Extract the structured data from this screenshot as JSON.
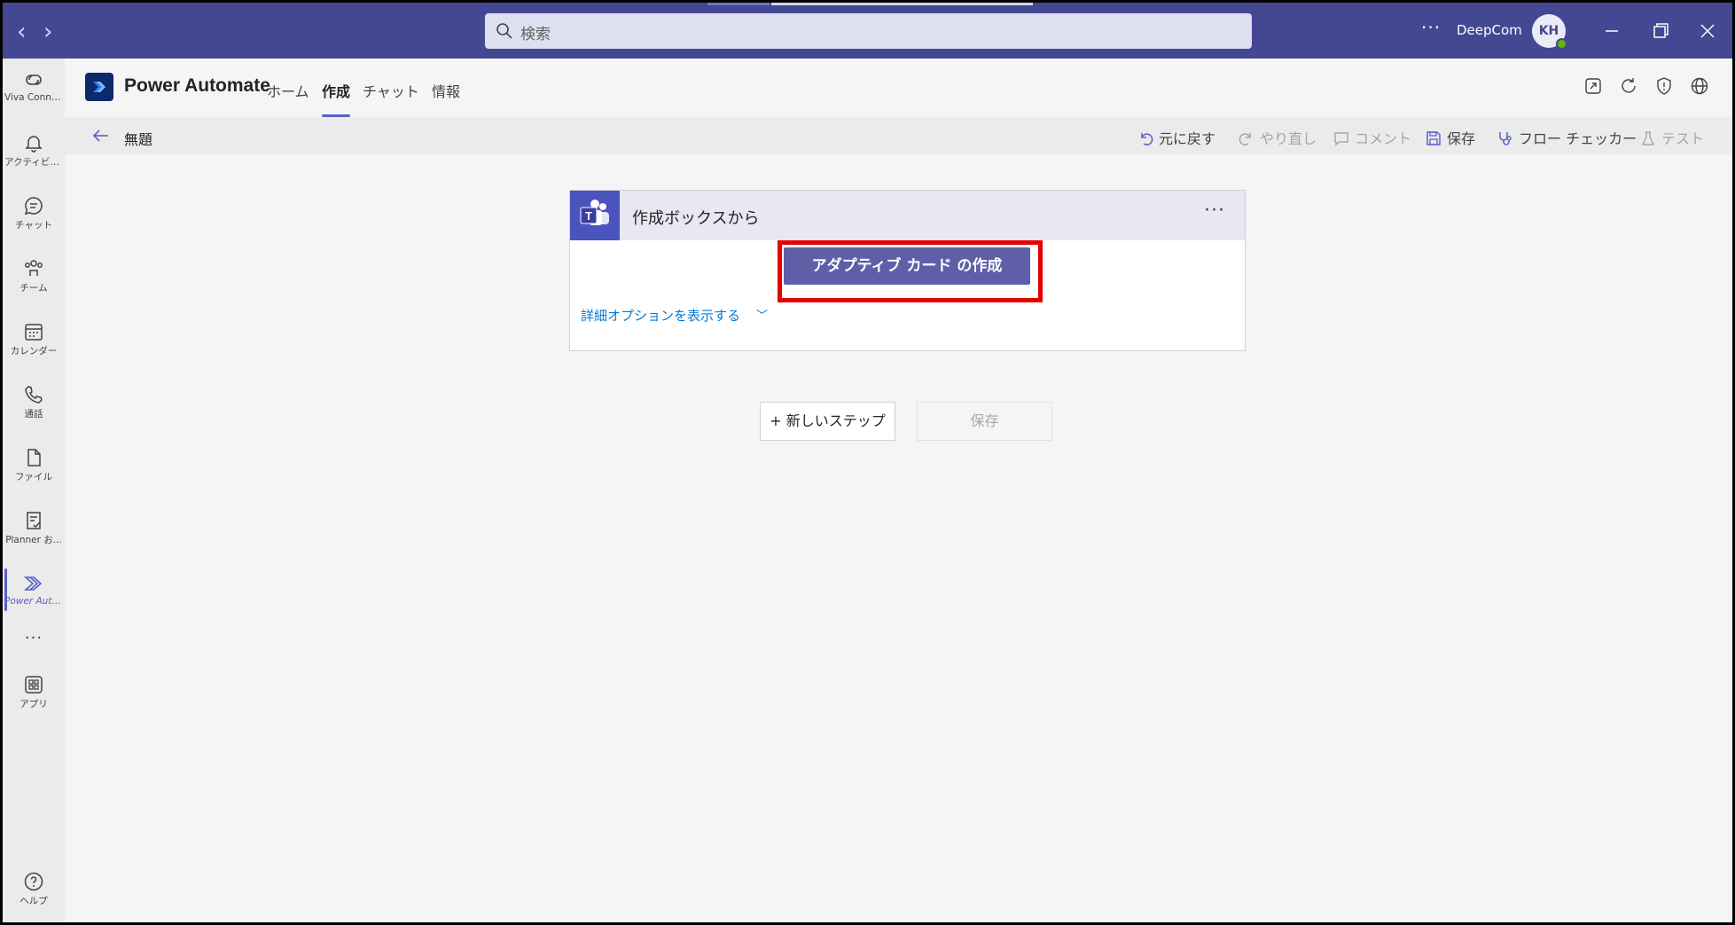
{
  "titlebar": {
    "search_placeholder": "検索",
    "more": "···",
    "org_name": "DeepCom",
    "avatar_initials": "KH"
  },
  "rail": {
    "items": [
      {
        "label": "Viva Conne..."
      },
      {
        "label": "アクティビティ"
      },
      {
        "label": "チャット"
      },
      {
        "label": "チーム"
      },
      {
        "label": "カレンダー"
      },
      {
        "label": "通話"
      },
      {
        "label": "ファイル"
      },
      {
        "label": "Planner お..."
      },
      {
        "label": "Power Auto..."
      },
      {
        "label": "アプリ"
      },
      {
        "label": "ヘルプ"
      }
    ],
    "more": "···"
  },
  "app": {
    "title": "Power Automate",
    "tabs": [
      {
        "label": "ホーム"
      },
      {
        "label": "作成"
      },
      {
        "label": "チャット"
      },
      {
        "label": "情報"
      }
    ],
    "active_tab": "作成"
  },
  "command_bar": {
    "flow_name": "無題",
    "undo": "元に戻す",
    "redo": "やり直し",
    "comment": "コメント",
    "save": "保存",
    "flow_checker": "フロー チェッカー",
    "test": "テスト"
  },
  "trigger_card": {
    "title": "作成ボックスから",
    "more": "···",
    "primary_button": "アダプティブ カード の作成",
    "advanced_link": "詳細オプションを表示する",
    "chevron": "﹀"
  },
  "footer_buttons": {
    "new_step": "+ 新しいステップ",
    "save": "保存"
  },
  "colors": {
    "titlebar": "#444791",
    "accent": "#5b5fc7",
    "primary_button": "#5f5fa8",
    "highlight": "#e60000",
    "link": "#0078d4"
  }
}
